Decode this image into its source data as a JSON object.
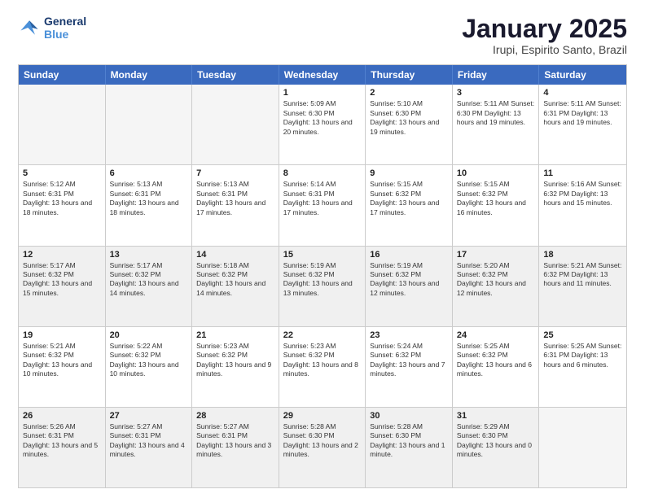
{
  "logo": {
    "line1": "General",
    "line2": "Blue"
  },
  "title": "January 2025",
  "subtitle": "Irupi, Espirito Santo, Brazil",
  "dayHeaders": [
    "Sunday",
    "Monday",
    "Tuesday",
    "Wednesday",
    "Thursday",
    "Friday",
    "Saturday"
  ],
  "weeks": [
    [
      {
        "day": "",
        "info": "",
        "empty": true
      },
      {
        "day": "",
        "info": "",
        "empty": true
      },
      {
        "day": "",
        "info": "",
        "empty": true
      },
      {
        "day": "1",
        "info": "Sunrise: 5:09 AM\nSunset: 6:30 PM\nDaylight: 13 hours\nand 20 minutes."
      },
      {
        "day": "2",
        "info": "Sunrise: 5:10 AM\nSunset: 6:30 PM\nDaylight: 13 hours\nand 19 minutes."
      },
      {
        "day": "3",
        "info": "Sunrise: 5:11 AM\nSunset: 6:30 PM\nDaylight: 13 hours\nand 19 minutes."
      },
      {
        "day": "4",
        "info": "Sunrise: 5:11 AM\nSunset: 6:31 PM\nDaylight: 13 hours\nand 19 minutes."
      }
    ],
    [
      {
        "day": "5",
        "info": "Sunrise: 5:12 AM\nSunset: 6:31 PM\nDaylight: 13 hours\nand 18 minutes."
      },
      {
        "day": "6",
        "info": "Sunrise: 5:13 AM\nSunset: 6:31 PM\nDaylight: 13 hours\nand 18 minutes."
      },
      {
        "day": "7",
        "info": "Sunrise: 5:13 AM\nSunset: 6:31 PM\nDaylight: 13 hours\nand 17 minutes."
      },
      {
        "day": "8",
        "info": "Sunrise: 5:14 AM\nSunset: 6:31 PM\nDaylight: 13 hours\nand 17 minutes."
      },
      {
        "day": "9",
        "info": "Sunrise: 5:15 AM\nSunset: 6:32 PM\nDaylight: 13 hours\nand 17 minutes."
      },
      {
        "day": "10",
        "info": "Sunrise: 5:15 AM\nSunset: 6:32 PM\nDaylight: 13 hours\nand 16 minutes."
      },
      {
        "day": "11",
        "info": "Sunrise: 5:16 AM\nSunset: 6:32 PM\nDaylight: 13 hours\nand 15 minutes."
      }
    ],
    [
      {
        "day": "12",
        "info": "Sunrise: 5:17 AM\nSunset: 6:32 PM\nDaylight: 13 hours\nand 15 minutes.",
        "shaded": true
      },
      {
        "day": "13",
        "info": "Sunrise: 5:17 AM\nSunset: 6:32 PM\nDaylight: 13 hours\nand 14 minutes.",
        "shaded": true
      },
      {
        "day": "14",
        "info": "Sunrise: 5:18 AM\nSunset: 6:32 PM\nDaylight: 13 hours\nand 14 minutes.",
        "shaded": true
      },
      {
        "day": "15",
        "info": "Sunrise: 5:19 AM\nSunset: 6:32 PM\nDaylight: 13 hours\nand 13 minutes.",
        "shaded": true
      },
      {
        "day": "16",
        "info": "Sunrise: 5:19 AM\nSunset: 6:32 PM\nDaylight: 13 hours\nand 12 minutes.",
        "shaded": true
      },
      {
        "day": "17",
        "info": "Sunrise: 5:20 AM\nSunset: 6:32 PM\nDaylight: 13 hours\nand 12 minutes.",
        "shaded": true
      },
      {
        "day": "18",
        "info": "Sunrise: 5:21 AM\nSunset: 6:32 PM\nDaylight: 13 hours\nand 11 minutes.",
        "shaded": true
      }
    ],
    [
      {
        "day": "19",
        "info": "Sunrise: 5:21 AM\nSunset: 6:32 PM\nDaylight: 13 hours\nand 10 minutes."
      },
      {
        "day": "20",
        "info": "Sunrise: 5:22 AM\nSunset: 6:32 PM\nDaylight: 13 hours\nand 10 minutes."
      },
      {
        "day": "21",
        "info": "Sunrise: 5:23 AM\nSunset: 6:32 PM\nDaylight: 13 hours\nand 9 minutes."
      },
      {
        "day": "22",
        "info": "Sunrise: 5:23 AM\nSunset: 6:32 PM\nDaylight: 13 hours\nand 8 minutes."
      },
      {
        "day": "23",
        "info": "Sunrise: 5:24 AM\nSunset: 6:32 PM\nDaylight: 13 hours\nand 7 minutes."
      },
      {
        "day": "24",
        "info": "Sunrise: 5:25 AM\nSunset: 6:32 PM\nDaylight: 13 hours\nand 6 minutes."
      },
      {
        "day": "25",
        "info": "Sunrise: 5:25 AM\nSunset: 6:31 PM\nDaylight: 13 hours\nand 6 minutes."
      }
    ],
    [
      {
        "day": "26",
        "info": "Sunrise: 5:26 AM\nSunset: 6:31 PM\nDaylight: 13 hours\nand 5 minutes.",
        "shaded": true
      },
      {
        "day": "27",
        "info": "Sunrise: 5:27 AM\nSunset: 6:31 PM\nDaylight: 13 hours\nand 4 minutes.",
        "shaded": true
      },
      {
        "day": "28",
        "info": "Sunrise: 5:27 AM\nSunset: 6:31 PM\nDaylight: 13 hours\nand 3 minutes.",
        "shaded": true
      },
      {
        "day": "29",
        "info": "Sunrise: 5:28 AM\nSunset: 6:30 PM\nDaylight: 13 hours\nand 2 minutes.",
        "shaded": true
      },
      {
        "day": "30",
        "info": "Sunrise: 5:28 AM\nSunset: 6:30 PM\nDaylight: 13 hours\nand 1 minute.",
        "shaded": true
      },
      {
        "day": "31",
        "info": "Sunrise: 5:29 AM\nSunset: 6:30 PM\nDaylight: 13 hours\nand 0 minutes.",
        "shaded": true
      },
      {
        "day": "",
        "info": "",
        "empty": true,
        "shaded": true
      }
    ]
  ]
}
